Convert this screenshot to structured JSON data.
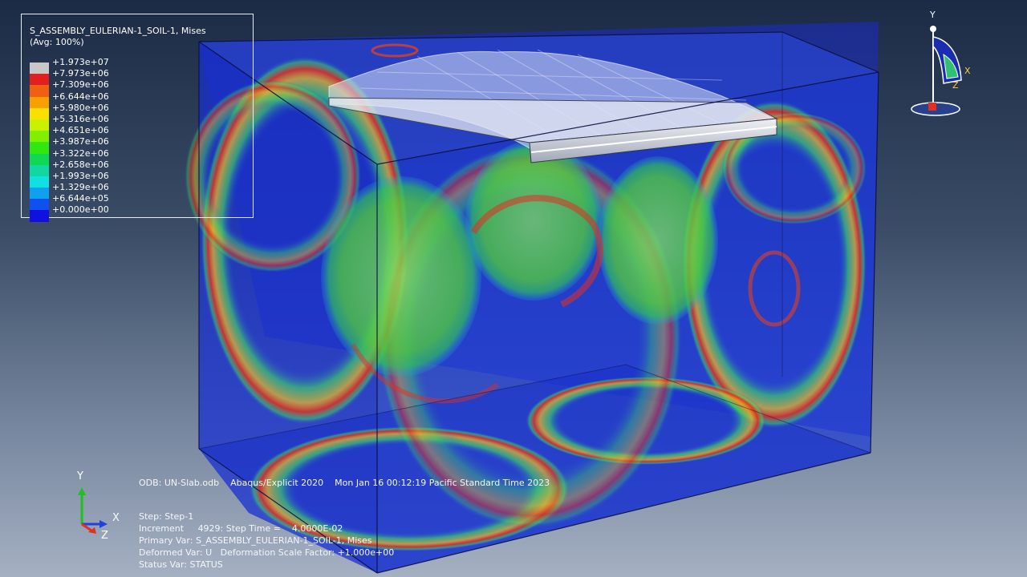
{
  "legend": {
    "title": "S_ASSEMBLY_EULERIAN-1_SOIL-1, Mises",
    "subtitle": "(Avg: 100%)",
    "entries": [
      {
        "label": "+1.973e+07",
        "color": "#c8c8c8"
      },
      {
        "label": "+7.973e+06",
        "color": "#e02020"
      },
      {
        "label": "+7.309e+06",
        "color": "#f06010"
      },
      {
        "label": "+6.644e+06",
        "color": "#f8a000"
      },
      {
        "label": "+5.980e+06",
        "color": "#f8e000"
      },
      {
        "label": "+5.316e+06",
        "color": "#c8f000"
      },
      {
        "label": "+4.651e+06",
        "color": "#80f000"
      },
      {
        "label": "+3.987e+06",
        "color": "#30e810"
      },
      {
        "label": "+3.322e+06",
        "color": "#10d850"
      },
      {
        "label": "+2.658e+06",
        "color": "#10d8a0"
      },
      {
        "label": "+1.993e+06",
        "color": "#10e0e0"
      },
      {
        "label": "+1.329e+06",
        "color": "#10a0f0"
      },
      {
        "label": "+6.644e+05",
        "color": "#1050f0"
      },
      {
        "label": "+0.000e+00",
        "color": "#1010e0"
      }
    ]
  },
  "info": {
    "odb": "ODB: UN-Slab.odb    Abaqus/Explicit 2020    Mon Jan 16 00:12:19 Pacific Standard Time 2023",
    "step": "Step: Step-1",
    "increment": "Increment     4929: Step Time =    4.0000E-02",
    "primary_var": "Primary Var: S_ASSEMBLY_EULERIAN-1_SOIL-1, Mises",
    "deformed_var": "Deformed Var: U   Deformation Scale Factor: +1.000e+00",
    "status_var": "Status Var: STATUS"
  },
  "triad_bottom": {
    "x": "X",
    "y": "Y",
    "z": "Z"
  },
  "triad_top": {
    "x": "X",
    "y": "Y",
    "z": "Z"
  },
  "colors": {
    "box_blue": "#1a3ad0",
    "ring_red": "#e03020",
    "ring_green": "#60e040",
    "background_top": "#1c2b45",
    "background_bottom": "#a5b0c2"
  }
}
